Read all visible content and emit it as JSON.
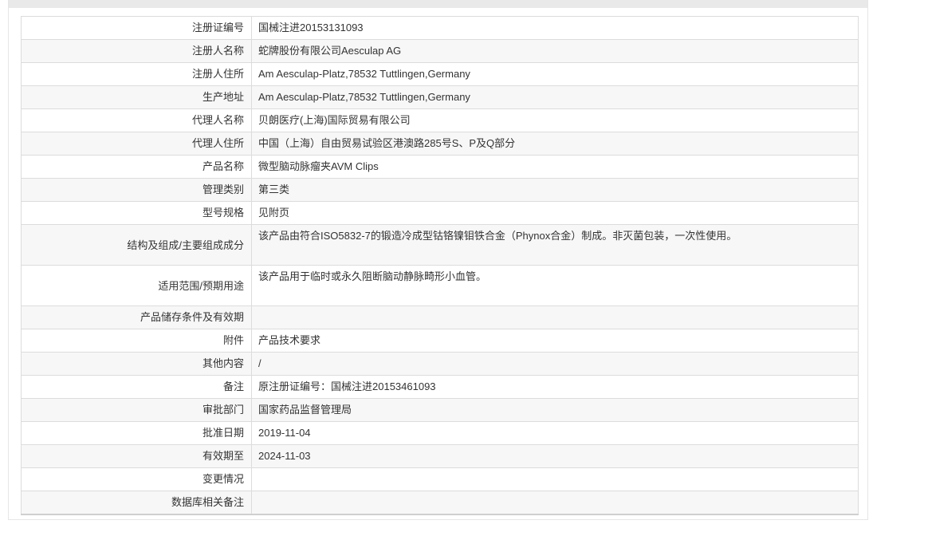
{
  "rows": [
    {
      "label": "注册证编号",
      "value": "国械注进20153131093"
    },
    {
      "label": "注册人名称",
      "value": "蛇牌股份有限公司Aesculap AG"
    },
    {
      "label": "注册人住所",
      "value": "Am Aesculap-Platz,78532 Tuttlingen,Germany"
    },
    {
      "label": "生产地址",
      "value": "Am Aesculap-Platz,78532 Tuttlingen,Germany"
    },
    {
      "label": "代理人名称",
      "value": "贝朗医疗(上海)国际贸易有限公司"
    },
    {
      "label": "代理人住所",
      "value": "中国（上海）自由贸易试验区港澳路285号S、P及Q部分"
    },
    {
      "label": "产品名称",
      "value": "微型脑动脉瘤夹AVM Clips"
    },
    {
      "label": "管理类别",
      "value": "第三类"
    },
    {
      "label": "型号规格",
      "value": "见附页"
    },
    {
      "label": "结构及组成/主要组成成分",
      "value": "该产品由符合ISO5832-7的锻造冷成型钴铬镍钼铁合金（Phynox合金）制成。非灭菌包装，一次性使用。"
    },
    {
      "label": "适用范围/预期用途",
      "value": "该产品用于临时或永久阻断脑动静脉畸形小血管。"
    },
    {
      "label": "产品储存条件及有效期",
      "value": ""
    },
    {
      "label": "附件",
      "value": "产品技术要求"
    },
    {
      "label": "其他内容",
      "value": "/"
    },
    {
      "label": "备注",
      "value": "原注册证编号：国械注进20153461093"
    },
    {
      "label": "审批部门",
      "value": "国家药品监督管理局"
    },
    {
      "label": "批准日期",
      "value": "2019-11-04"
    },
    {
      "label": "有效期至",
      "value": "2024-11-03"
    },
    {
      "label": "变更情况",
      "value": ""
    },
    {
      "label": "数据库相关备注",
      "value": ""
    }
  ]
}
